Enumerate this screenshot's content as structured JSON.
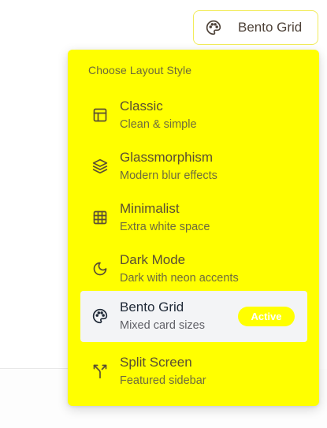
{
  "trigger": {
    "label": "Bento Grid",
    "icon": "palette-icon"
  },
  "menu": {
    "heading": "Choose Layout Style",
    "active_badge": "Active",
    "items": [
      {
        "title": "Classic",
        "description": "Clean & simple",
        "icon": "layout-panel-icon",
        "active": false
      },
      {
        "title": "Glassmorphism",
        "description": "Modern blur effects",
        "icon": "layers-icon",
        "active": false
      },
      {
        "title": "Minimalist",
        "description": "Extra white space",
        "icon": "grid-icon",
        "active": false
      },
      {
        "title": "Dark Mode",
        "description": "Dark with neon accents",
        "icon": "moon-icon",
        "active": false
      },
      {
        "title": "Bento Grid",
        "description": "Mixed card sizes",
        "icon": "palette-icon",
        "active": true
      },
      {
        "title": "Split Screen",
        "description": "Featured sidebar",
        "icon": "split-icon",
        "active": false
      }
    ]
  },
  "colors": {
    "menu_background": "#ffff00",
    "active_item_background": "#f3f4f6",
    "trigger_border": "#f2ec5a",
    "text": "#5a4e33"
  }
}
